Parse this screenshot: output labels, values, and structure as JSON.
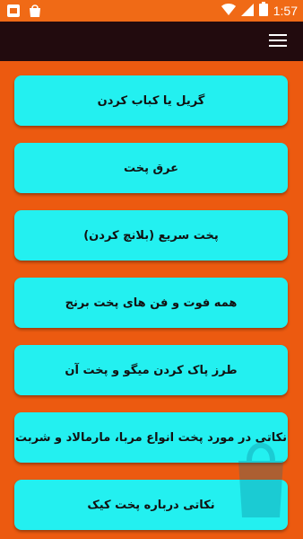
{
  "status_bar": {
    "time": "1:57",
    "icons": [
      "notification-icon",
      "shopping-bag-icon",
      "wifi-icon",
      "signal-icon",
      "battery-icon"
    ]
  },
  "app_bar": {
    "menu_icon": "hamburger-menu-icon",
    "background": "#220b0e"
  },
  "theme": {
    "accent": "#ec5a10",
    "card": "#23f0f0"
  },
  "items": [
    {
      "label": "گریل یا کباب کردن"
    },
    {
      "label": "عرق پخت"
    },
    {
      "label": "پخت سریع (بلانچ کردن)"
    },
    {
      "label": "همه فوت و فن های پخت برنج"
    },
    {
      "label": "طرز پاک کردن میگو و پخت آن"
    },
    {
      "label": "نکاتی در مورد پخت انواع مربا، مارمالاد و شربت"
    },
    {
      "label": "نکاتی درباره پخت کیک"
    }
  ]
}
